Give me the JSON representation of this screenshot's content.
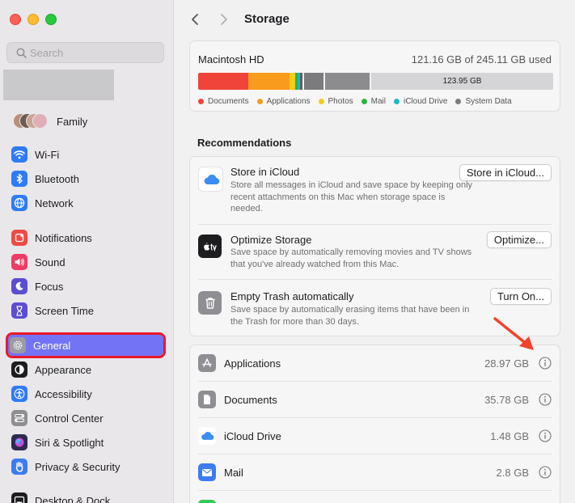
{
  "sidebar": {
    "search_placeholder": "Search",
    "family_label": "Family",
    "items": [
      {
        "label": "Wi-Fi",
        "icon": "wifi-icon",
        "color": "#2f7bf6"
      },
      {
        "label": "Bluetooth",
        "icon": "bluetooth-icon",
        "color": "#2f7bf6"
      },
      {
        "label": "Network",
        "icon": "globe-icon",
        "color": "#2f7bf6"
      },
      {
        "label": "Notifications",
        "icon": "bell-icon",
        "color": "#ee4b46"
      },
      {
        "label": "Sound",
        "icon": "speaker-icon",
        "color": "#ee3c64"
      },
      {
        "label": "Focus",
        "icon": "moon-icon",
        "color": "#5b4ed0"
      },
      {
        "label": "Screen Time",
        "icon": "hourglass-icon",
        "color": "#5b4ed0"
      },
      {
        "label": "General",
        "icon": "gear-icon",
        "color": "#8e8e93"
      },
      {
        "label": "Appearance",
        "icon": "appearance-icon",
        "color": "#1d1d1f"
      },
      {
        "label": "Accessibility",
        "icon": "accessibility-icon",
        "color": "#2f7bf6"
      },
      {
        "label": "Control Center",
        "icon": "control-center-icon",
        "color": "#8e8e93"
      },
      {
        "label": "Siri & Spotlight",
        "icon": "siri-icon",
        "color": "#3a3a6a"
      },
      {
        "label": "Privacy & Security",
        "icon": "hand-icon",
        "color": "#3d7cf0"
      },
      {
        "label": "Desktop & Dock",
        "icon": "dock-icon",
        "color": "#1d1d1f"
      }
    ]
  },
  "toolbar": {
    "title": "Storage"
  },
  "disk": {
    "name": "Macintosh HD",
    "usage": "121.16 GB of 245.11 GB used",
    "free_label": "123.95 GB",
    "legend": [
      {
        "label": "Documents",
        "color": "#f0443a"
      },
      {
        "label": "Applications",
        "color": "#f99b1c"
      },
      {
        "label": "Photos",
        "color": "#f6cd17"
      },
      {
        "label": "Mail",
        "color": "#2bb63c"
      },
      {
        "label": "iCloud Drive",
        "color": "#1fb6c9"
      },
      {
        "label": "System Data",
        "color": "#7b7b7d"
      }
    ]
  },
  "recommendations": {
    "heading": "Recommendations",
    "items": [
      {
        "title": "Store in iCloud",
        "description": "Store all messages in iCloud and save space by keeping only recent attachments on this Mac when storage space is needed.",
        "button": "Store in iCloud...",
        "icon": "icloud-icon"
      },
      {
        "title": "Optimize Storage",
        "description": "Save space by automatically removing movies and TV shows that you've already watched from this Mac.",
        "button": "Optimize...",
        "icon": "apple-tv-icon"
      },
      {
        "title": "Empty Trash automatically",
        "description": "Save space by automatically erasing items that have been in the Trash for more than 30 days.",
        "button": "Turn On...",
        "icon": "trash-icon"
      }
    ]
  },
  "categories": [
    {
      "label": "Applications",
      "size": "28.97 GB",
      "icon": "applications-icon"
    },
    {
      "label": "Documents",
      "size": "35.78 GB",
      "icon": "document-icon"
    },
    {
      "label": "iCloud Drive",
      "size": "1.48 GB",
      "icon": "icloud-icon"
    },
    {
      "label": "Mail",
      "size": "2.8 GB",
      "icon": "mail-icon"
    }
  ]
}
